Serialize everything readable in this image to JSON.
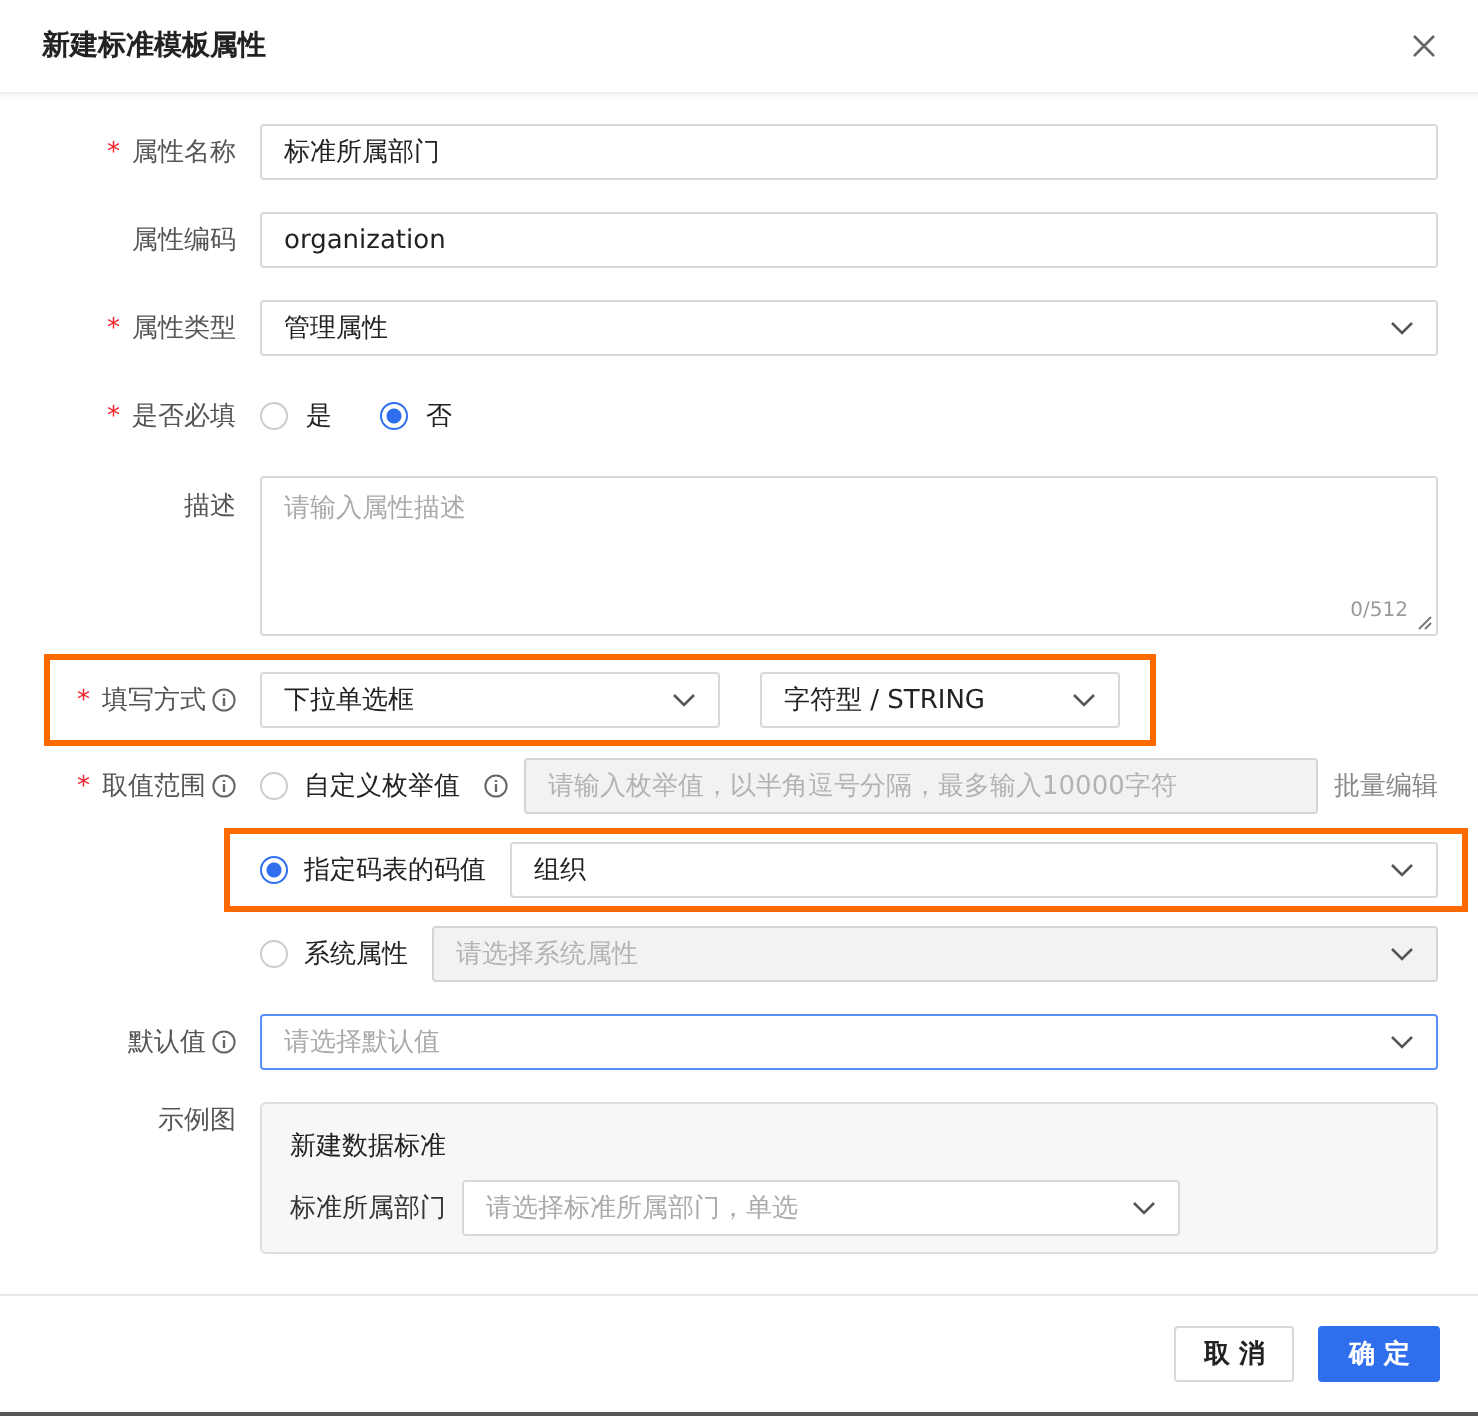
{
  "dialog": {
    "title": "新建标准模板属性"
  },
  "fields": [
    {
      "kind": "text",
      "required_mark": "*",
      "label": "属性名称",
      "value": "标准所属部门"
    },
    {
      "kind": "text",
      "label": "属性编码",
      "value": "organization"
    },
    {
      "kind": "select",
      "required_mark": "*",
      "label": "属性类型",
      "value": "管理属性"
    },
    {
      "kind": "radio",
      "required_mark": "*",
      "label": "是否必填",
      "options": [
        {
          "label": "是",
          "selected": false
        },
        {
          "label": "否",
          "selected": true
        }
      ]
    },
    {
      "kind": "textarea",
      "label": "描述",
      "placeholder": "请输入属性描述",
      "counter": "0/512"
    },
    {
      "kind": "selects",
      "required_mark": "*",
      "label": "填写方式",
      "info": true,
      "highlighted": true,
      "selects": [
        {
          "value": "下拉单选框"
        },
        {
          "value": "字符型 / STRING"
        }
      ]
    },
    {
      "kind": "range",
      "required_mark": "*",
      "label": "取值范围",
      "info": true,
      "options": [
        {
          "kind": "input",
          "label": "自定义枚举值",
          "info": true,
          "selected": false,
          "highlighted": false,
          "disabled": true,
          "placeholder": "请输入枚举值，以半角逗号分隔，最多输入10000字符",
          "action": "批量编辑"
        },
        {
          "kind": "select",
          "label": "指定码表的码值",
          "selected": true,
          "highlighted": true,
          "disabled": false,
          "value": "组织"
        },
        {
          "kind": "select",
          "label": "系统属性",
          "selected": false,
          "highlighted": false,
          "disabled": true,
          "placeholder": "请选择系统属性"
        }
      ]
    },
    {
      "kind": "select",
      "label": "默认值",
      "info": true,
      "focused": true,
      "placeholder": "请选择默认值"
    },
    {
      "kind": "example",
      "label": "示例图",
      "title": "新建数据标准",
      "field_label": "标准所属部门",
      "placeholder": "请选择标准所属部门，单选"
    }
  ],
  "buttons": [
    {
      "label": "取 消",
      "primary": false
    },
    {
      "label": "确 定",
      "primary": true
    }
  ]
}
